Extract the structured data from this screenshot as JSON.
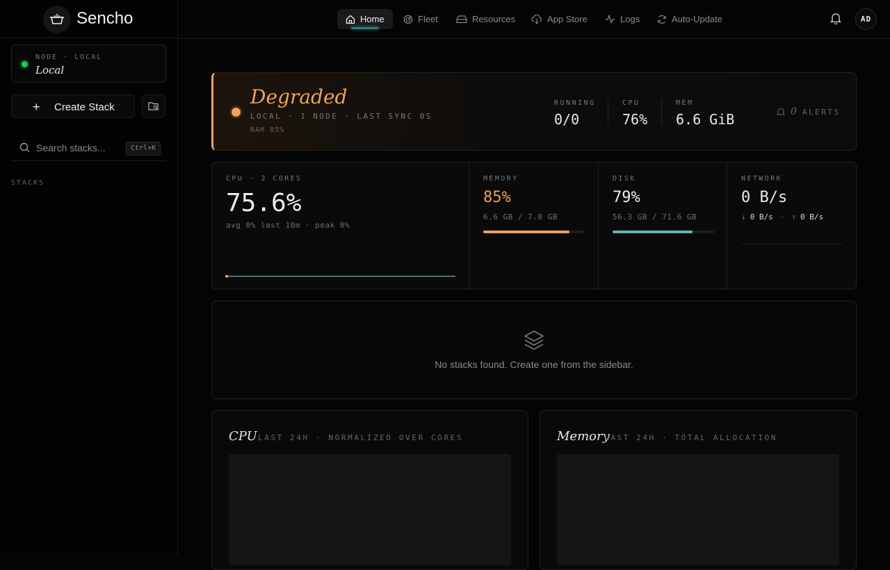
{
  "brand": {
    "name": "Sencho"
  },
  "node": {
    "meta": "NODE · LOCAL",
    "name": "Local"
  },
  "sidebar": {
    "create_label": "Create Stack",
    "search_placeholder": "Search stacks...",
    "search_shortcut": "Ctrl+K",
    "stacks_heading": "STACKS"
  },
  "nav": {
    "items": [
      {
        "label": "Home",
        "icon": "home-icon",
        "active": true
      },
      {
        "label": "Fleet",
        "icon": "radar-icon"
      },
      {
        "label": "Resources",
        "icon": "hard-drive-icon"
      },
      {
        "label": "App Store",
        "icon": "cloud-download-icon"
      },
      {
        "label": "Logs",
        "icon": "activity-icon"
      },
      {
        "label": "Auto-Update",
        "icon": "refresh-icon"
      }
    ],
    "avatar": "AD"
  },
  "status": {
    "title": "Degraded",
    "subtitle": "LOCAL · 1 NODE · LAST SYNC 0S",
    "ram": "RAM 85%",
    "kpis": [
      {
        "label": "RUNNING",
        "value": "0/0"
      },
      {
        "label": "CPU",
        "value": "76%"
      },
      {
        "label": "MEM",
        "value": "6.6 GiB"
      }
    ],
    "alerts_count": "0",
    "alerts_label": "ALERTS",
    "color": "#f0a15a"
  },
  "metrics": {
    "cpu": {
      "label": "CPU · 2 CORES",
      "value": "75.6%",
      "detail": "avg 0% last 10m · peak 0%"
    },
    "memory": {
      "label": "MEMORY",
      "value": "85%",
      "detail": "6.6 GB / 7.8 GB",
      "fill": 0.85,
      "color": "#f0a15a"
    },
    "disk": {
      "label": "DISK",
      "value": "79%",
      "detail": "56.3 GB / 71.6 GB",
      "fill": 0.79,
      "color": "#5fb8b0"
    },
    "network": {
      "label": "NETWORK",
      "value": "0 B/s",
      "down": "0 B/s",
      "up": "0 B/s"
    }
  },
  "empty": {
    "text": "No stacks found. Create one from the sidebar."
  },
  "charts": {
    "cpu": {
      "title": "CPU",
      "subtitle": "LAST 24H · NORMALIZED OVER CORES"
    },
    "memory": {
      "title": "Memory",
      "subtitle": "LAST 24H · TOTAL ALLOCATION"
    }
  }
}
